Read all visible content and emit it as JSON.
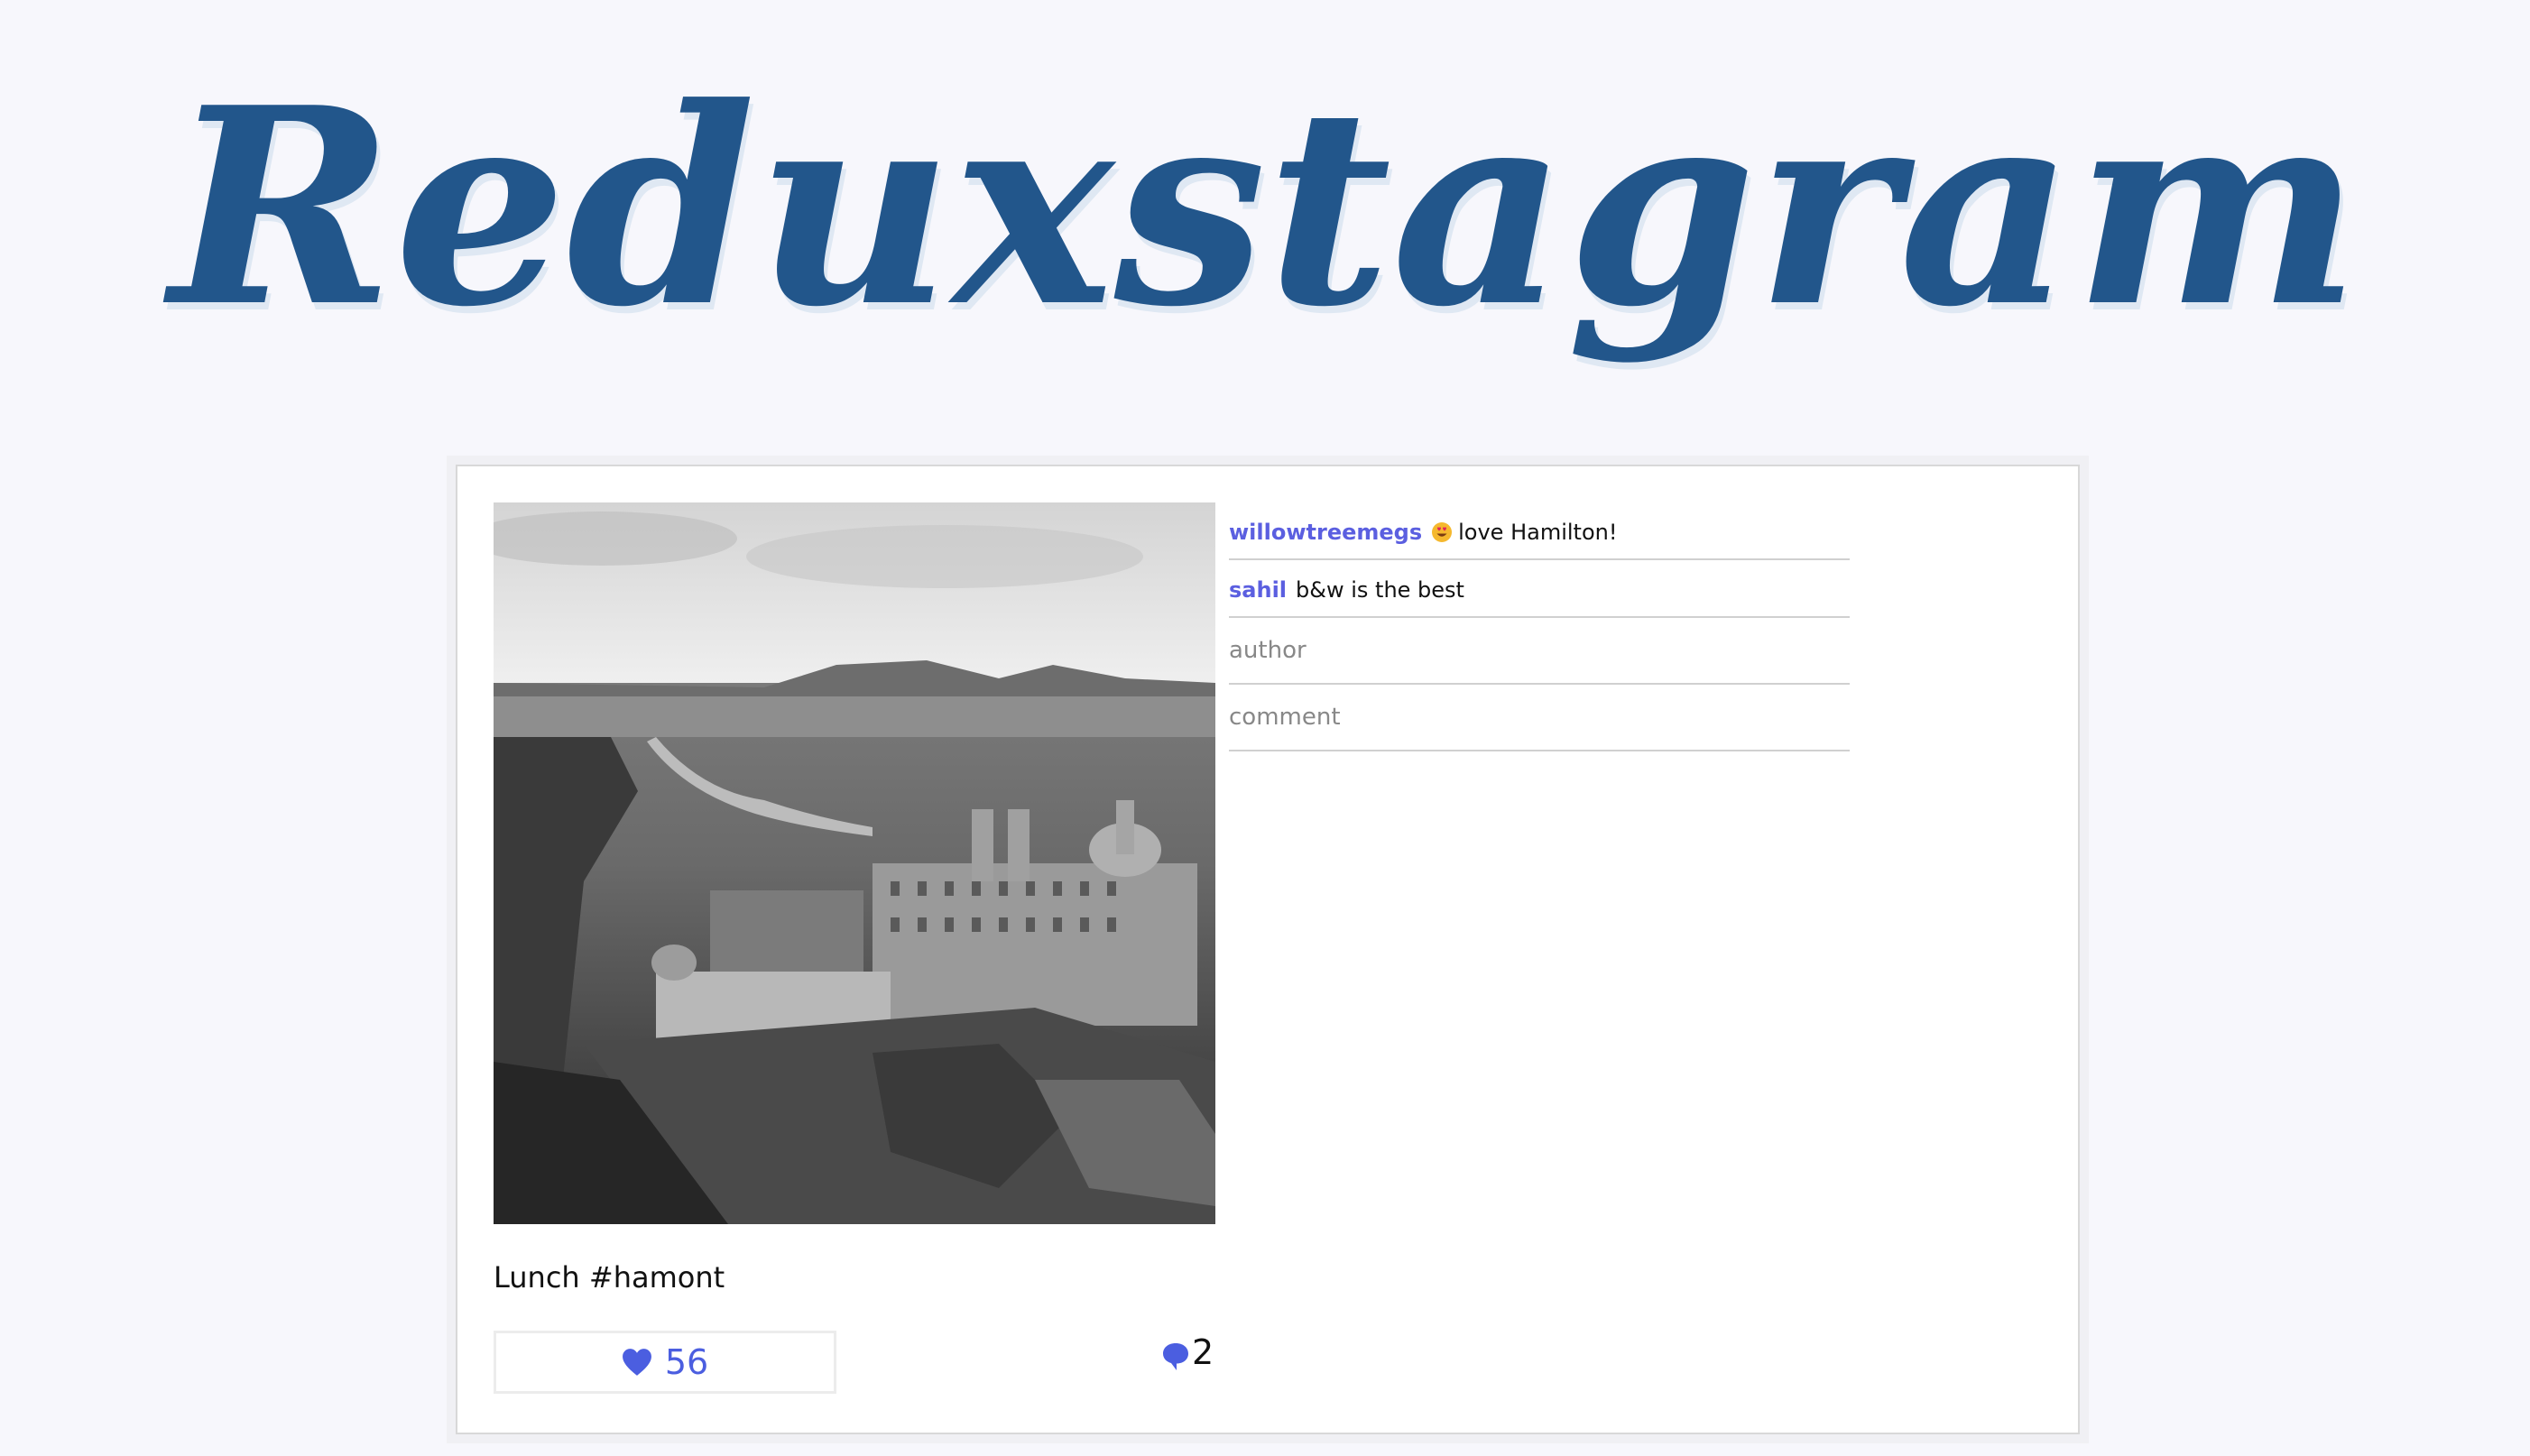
{
  "app": {
    "title": "Reduxstagram",
    "title_color": "#22568b"
  },
  "post": {
    "caption": "Lunch #hamont",
    "likes": "56",
    "comment_count": "2",
    "accent_color": "#4b5ee0"
  },
  "comments": [
    {
      "user": "willowtreemegs",
      "emoji": "heart-eyes-emoji",
      "text": "love Hamilton!"
    },
    {
      "user": "sahil",
      "text": "b&w is the best"
    }
  ],
  "form": {
    "author_placeholder": "author",
    "comment_placeholder": "comment"
  },
  "icons": {
    "like": "heart-icon",
    "comments": "speech-bubble-icon"
  }
}
